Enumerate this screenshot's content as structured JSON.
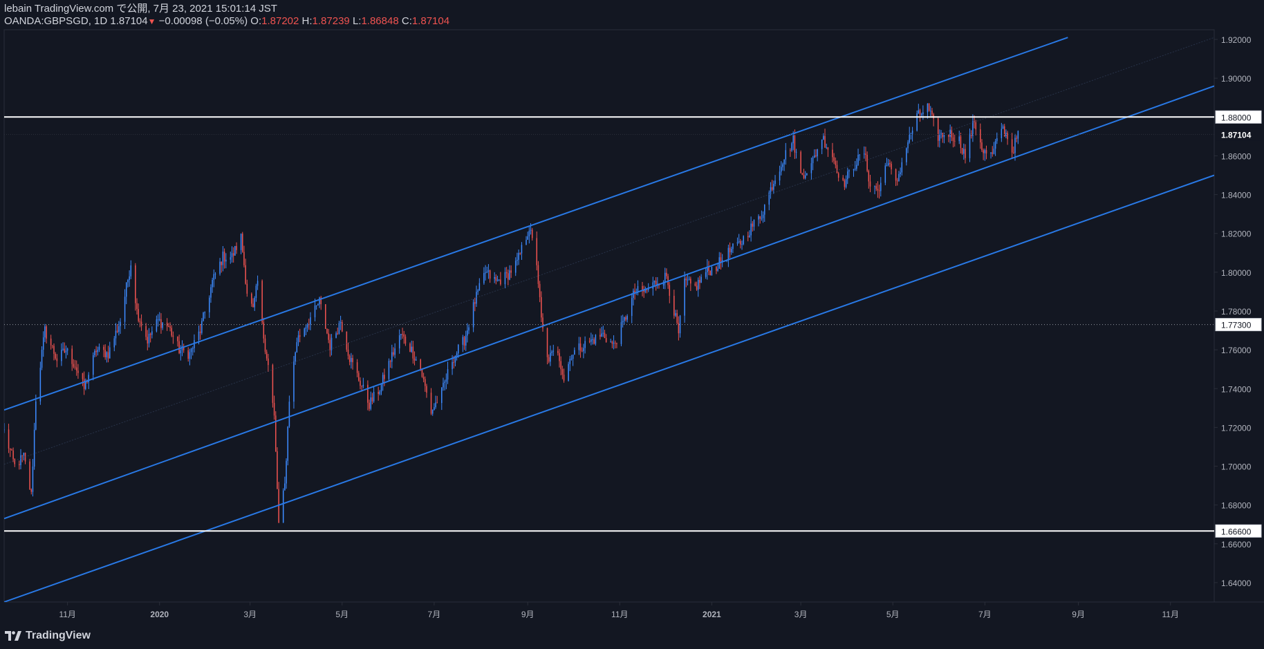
{
  "header": {
    "published": "lebain TradingView.com で公開, 7月 23, 2021 15:01:14 JST",
    "symbol": "OANDA:GBPSGD, 1D",
    "last": "1.87104",
    "change": "−0.00098 (−0.05%)",
    "o_label": "O:",
    "o_value": "1.87202",
    "h_label": "H:",
    "h_value": "1.87239",
    "l_label": "L:",
    "l_value": "1.86848",
    "c_label": "C:",
    "c_value": "1.87104"
  },
  "footer": {
    "brand": "TradingView"
  },
  "colors": {
    "background": "#131722",
    "up": "#2962ff",
    "up_light": "#3d8bff",
    "down": "#ef5350",
    "channel": "#2979e6",
    "level": "#ffffff",
    "axis_text": "#b2b5be",
    "border": "#2a2e39"
  },
  "chart_data": {
    "type": "candlestick",
    "symbol": "OANDA:GBPSGD",
    "interval": "1D",
    "ylim": [
      1.63,
      1.925
    ],
    "y_ticks": [
      "1.64000",
      "1.66000",
      "1.68000",
      "1.70000",
      "1.72000",
      "1.74000",
      "1.76000",
      "1.78000",
      "1.80000",
      "1.82000",
      "1.84000",
      "1.86000",
      "1.88000",
      "1.90000",
      "1.92000"
    ],
    "x_range": [
      "2019-09-20",
      "2021-11-30"
    ],
    "x_ticks": [
      {
        "date": "2019-11-01",
        "label": "11月"
      },
      {
        "date": "2020-01-01",
        "label": "2020"
      },
      {
        "date": "2020-03-01",
        "label": "3月"
      },
      {
        "date": "2020-05-01",
        "label": "5月"
      },
      {
        "date": "2020-07-01",
        "label": "7月"
      },
      {
        "date": "2020-09-01",
        "label": "9月"
      },
      {
        "date": "2020-11-01",
        "label": "11月"
      },
      {
        "date": "2021-01-01",
        "label": "2021"
      },
      {
        "date": "2021-03-01",
        "label": "3月"
      },
      {
        "date": "2021-05-01",
        "label": "5月"
      },
      {
        "date": "2021-07-01",
        "label": "7月"
      },
      {
        "date": "2021-09-01",
        "label": "9月"
      },
      {
        "date": "2021-11-01",
        "label": "11月"
      }
    ],
    "close_path": [
      [
        "2019-09-20",
        1.718
      ],
      [
        "2019-09-27",
        1.7
      ],
      [
        "2019-10-03",
        1.705
      ],
      [
        "2019-10-08",
        1.685
      ],
      [
        "2019-10-11",
        1.735
      ],
      [
        "2019-10-17",
        1.77
      ],
      [
        "2019-10-25",
        1.755
      ],
      [
        "2019-10-31",
        1.76
      ],
      [
        "2019-11-06",
        1.752
      ],
      [
        "2019-11-12",
        1.74
      ],
      [
        "2019-11-20",
        1.76
      ],
      [
        "2019-11-28",
        1.758
      ],
      [
        "2019-12-06",
        1.775
      ],
      [
        "2019-12-13",
        1.805
      ],
      [
        "2019-12-17",
        1.78
      ],
      [
        "2019-12-24",
        1.765
      ],
      [
        "2019-12-31",
        1.775
      ],
      [
        "2020-01-07",
        1.772
      ],
      [
        "2020-01-14",
        1.76
      ],
      [
        "2020-01-21",
        1.758
      ],
      [
        "2020-01-28",
        1.77
      ],
      [
        "2020-02-05",
        1.795
      ],
      [
        "2020-02-12",
        1.808
      ],
      [
        "2020-02-18",
        1.808
      ],
      [
        "2020-02-24",
        1.818
      ],
      [
        "2020-02-28",
        1.79
      ],
      [
        "2020-03-03",
        1.78
      ],
      [
        "2020-03-06",
        1.795
      ],
      [
        "2020-03-09",
        1.772
      ],
      [
        "2020-03-13",
        1.752
      ],
      [
        "2020-03-17",
        1.725
      ],
      [
        "2020-03-20",
        1.67
      ],
      [
        "2020-03-24",
        1.69
      ],
      [
        "2020-03-27",
        1.735
      ],
      [
        "2020-04-01",
        1.765
      ],
      [
        "2020-04-07",
        1.773
      ],
      [
        "2020-04-13",
        1.78
      ],
      [
        "2020-04-16",
        1.785
      ],
      [
        "2020-04-23",
        1.762
      ],
      [
        "2020-04-30",
        1.775
      ],
      [
        "2020-05-06",
        1.756
      ],
      [
        "2020-05-12",
        1.745
      ],
      [
        "2020-05-19",
        1.732
      ],
      [
        "2020-05-26",
        1.74
      ],
      [
        "2020-06-02",
        1.755
      ],
      [
        "2020-06-09",
        1.768
      ],
      [
        "2020-06-16",
        1.76
      ],
      [
        "2020-06-22",
        1.75
      ],
      [
        "2020-06-29",
        1.728
      ],
      [
        "2020-07-06",
        1.738
      ],
      [
        "2020-07-13",
        1.755
      ],
      [
        "2020-07-21",
        1.765
      ],
      [
        "2020-07-28",
        1.785
      ],
      [
        "2020-08-04",
        1.8
      ],
      [
        "2020-08-11",
        1.795
      ],
      [
        "2020-08-18",
        1.798
      ],
      [
        "2020-08-25",
        1.805
      ],
      [
        "2020-09-02",
        1.823
      ],
      [
        "2020-09-07",
        1.805
      ],
      [
        "2020-09-10",
        1.775
      ],
      [
        "2020-09-14",
        1.755
      ],
      [
        "2020-09-21",
        1.76
      ],
      [
        "2020-09-25",
        1.745
      ],
      [
        "2020-09-30",
        1.758
      ],
      [
        "2020-10-07",
        1.762
      ],
      [
        "2020-10-14",
        1.765
      ],
      [
        "2020-10-21",
        1.768
      ],
      [
        "2020-10-28",
        1.762
      ],
      [
        "2020-11-04",
        1.775
      ],
      [
        "2020-11-11",
        1.79
      ],
      [
        "2020-11-18",
        1.79
      ],
      [
        "2020-11-25",
        1.795
      ],
      [
        "2020-12-02",
        1.798
      ],
      [
        "2020-12-07",
        1.78
      ],
      [
        "2020-12-10",
        1.768
      ],
      [
        "2020-12-14",
        1.795
      ],
      [
        "2020-12-21",
        1.792
      ],
      [
        "2020-12-28",
        1.8
      ],
      [
        "2021-01-04",
        1.803
      ],
      [
        "2021-01-12",
        1.81
      ],
      [
        "2021-01-20",
        1.815
      ],
      [
        "2021-01-27",
        1.823
      ],
      [
        "2021-02-03",
        1.83
      ],
      [
        "2021-02-10",
        1.845
      ],
      [
        "2021-02-17",
        1.858
      ],
      [
        "2021-02-24",
        1.868
      ],
      [
        "2021-03-01",
        1.85
      ],
      [
        "2021-03-08",
        1.855
      ],
      [
        "2021-03-15",
        1.87
      ],
      [
        "2021-03-22",
        1.86
      ],
      [
        "2021-03-29",
        1.845
      ],
      [
        "2021-04-05",
        1.855
      ],
      [
        "2021-04-12",
        1.862
      ],
      [
        "2021-04-16",
        1.845
      ],
      [
        "2021-04-22",
        1.842
      ],
      [
        "2021-04-27",
        1.858
      ],
      [
        "2021-05-03",
        1.845
      ],
      [
        "2021-05-10",
        1.865
      ],
      [
        "2021-05-17",
        1.88
      ],
      [
        "2021-05-24",
        1.885
      ],
      [
        "2021-05-31",
        1.87
      ],
      [
        "2021-06-07",
        1.872
      ],
      [
        "2021-06-14",
        1.868
      ],
      [
        "2021-06-18",
        1.86
      ],
      [
        "2021-06-24",
        1.878
      ],
      [
        "2021-06-30",
        1.862
      ],
      [
        "2021-07-06",
        1.86
      ],
      [
        "2021-07-12",
        1.875
      ],
      [
        "2021-07-16",
        1.87
      ],
      [
        "2021-07-19",
        1.862
      ],
      [
        "2021-07-23",
        1.871
      ]
    ],
    "horizontal_levels": [
      {
        "price": 1.88,
        "label": "1.88000",
        "style": "solid"
      },
      {
        "price": 1.6666,
        "label": "1.66600",
        "style": "solid"
      },
      {
        "price": 1.773,
        "label": "1.77300",
        "style": "dotted"
      }
    ],
    "last_price": {
      "price": 1.87104,
      "label": "1.87104"
    },
    "channel_lines": [
      {
        "name": "upper",
        "from": [
          "2019-09-20",
          1.729
        ],
        "to": [
          "2021-08-25",
          1.921
        ]
      },
      {
        "name": "mid",
        "from": [
          "2019-09-20",
          1.673
        ],
        "to": [
          "2021-11-30",
          1.896
        ]
      },
      {
        "name": "lower",
        "from": [
          "2019-09-20",
          1.63
        ],
        "to": [
          "2021-11-30",
          1.85
        ]
      },
      {
        "name": "faint",
        "from": [
          "2019-09-20",
          1.701
        ],
        "to": [
          "2021-11-30",
          1.921
        ],
        "style": "faint"
      }
    ]
  }
}
